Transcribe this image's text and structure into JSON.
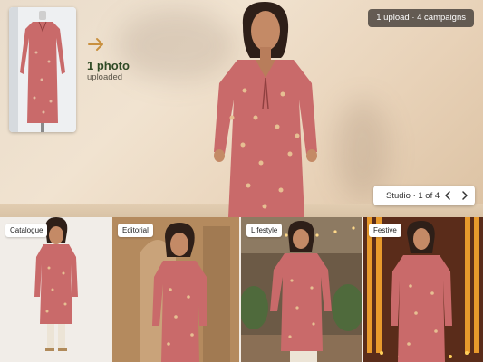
{
  "hero": {
    "upload_count": "1 photo",
    "upload_sub": "uploaded",
    "summary_pill": "1 upload · 4 campaigns",
    "pager_text": "Studio · 1 of 4"
  },
  "strip": {
    "tiles": [
      {
        "label": "Catalogue"
      },
      {
        "label": "Editorial"
      },
      {
        "label": "Lifestyle"
      },
      {
        "label": "Festive"
      }
    ]
  },
  "colors": {
    "kurta": "#c96a6a",
    "accent_green": "#2f4a25",
    "arrow": "#c9903f"
  },
  "icons": [
    "arrow-right-icon",
    "chevron-left-icon",
    "chevron-right-icon"
  ]
}
